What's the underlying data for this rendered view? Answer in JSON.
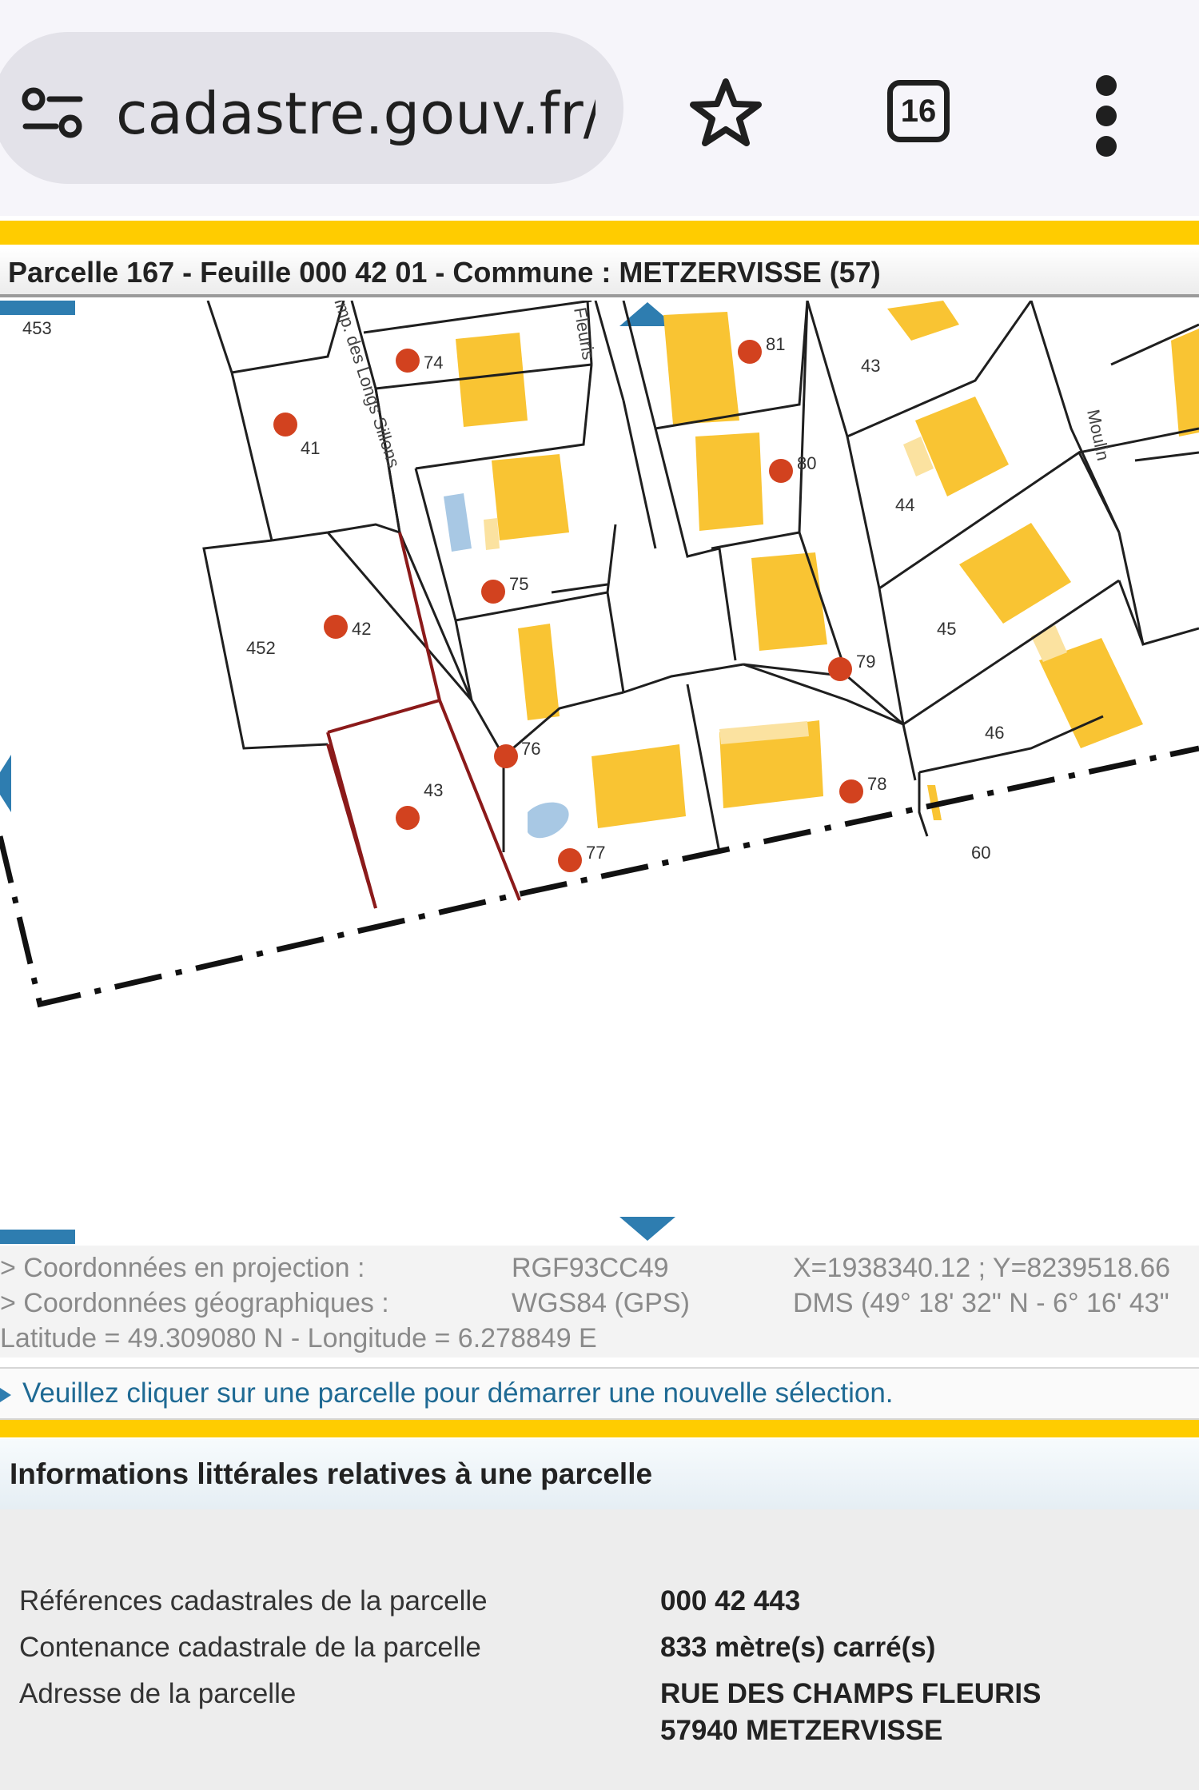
{
  "browser": {
    "url_text": "cadastre.gouv.fr/s",
    "tab_count": "16",
    "icons": [
      "site-settings-icon",
      "bookmark-star-icon",
      "tab-switcher-icon",
      "overflow-menu-icon"
    ]
  },
  "header": {
    "title": "Parcelle 167 - Feuille 000 42 01 - Commune : METZERVISSE (57)"
  },
  "map": {
    "parcel_labels": [
      "453",
      "452",
      "43",
      "44",
      "45",
      "46",
      "60"
    ],
    "marker_numbers": [
      "74",
      "41",
      "42",
      "43",
      "75",
      "76",
      "77",
      "78",
      "79",
      "80",
      "81"
    ],
    "street_labels": [
      "Imp. des Longs Sillons",
      "Fleuris",
      "Moulin"
    ],
    "colors": {
      "building": "#f9c433",
      "building_light": "#fbe2a0",
      "water": "#a8c8e4",
      "selected_parcel": "#8b1a1a",
      "marker": "#d2421f",
      "nav_arrow": "#2e7db0"
    }
  },
  "coords": {
    "projection_label": "> Coordonnées en projection :",
    "projection_system": "RGF93CC49",
    "projection_value": "X=1938340.12 ; Y=8239518.66",
    "geographic_label": "> Coordonnées géographiques :",
    "geographic_system": "WGS84 (GPS)",
    "geographic_value": "DMS (49° 18' 32\" N - 6° 16' 43\"",
    "latlon": "Latitude = 49.309080 N - Longitude = 6.278849 E"
  },
  "notice": "Veuillez cliquer sur une parcelle pour démarrer une nouvelle sélection.",
  "info": {
    "title": "Informations littérales relatives à une parcelle",
    "rows": [
      {
        "label": "Références cadastrales de la parcelle",
        "value": "000 42 443"
      },
      {
        "label": "Contenance cadastrale de la parcelle",
        "value": "833 mètre(s) carré(s)"
      },
      {
        "label": "Adresse de la parcelle",
        "value": "RUE DES CHAMPS FLEURIS",
        "value2": "57940 METZERVISSE"
      }
    ]
  }
}
